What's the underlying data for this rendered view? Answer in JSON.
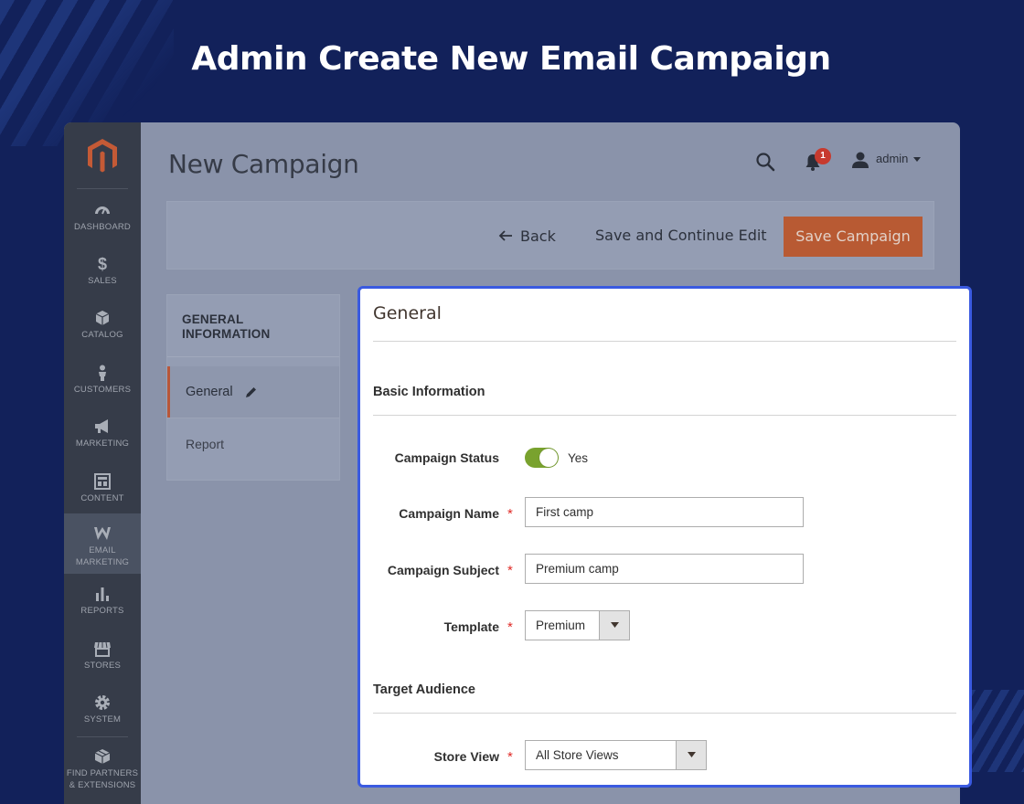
{
  "banner": {
    "title": "Admin Create New Email Campaign"
  },
  "sidebar": {
    "logo_icon": "magento-logo-icon",
    "items": [
      {
        "label": "DASHBOARD",
        "icon": "dashboard-icon"
      },
      {
        "label": "SALES",
        "icon": "dollar-icon"
      },
      {
        "label": "CATALOG",
        "icon": "cube-icon"
      },
      {
        "label": "CUSTOMERS",
        "icon": "person-icon"
      },
      {
        "label": "MARKETING",
        "icon": "megaphone-icon"
      },
      {
        "label": "CONTENT",
        "icon": "layout-icon"
      },
      {
        "label": "EMAIL MARKETING",
        "icon": "email-marketing-icon"
      },
      {
        "label": "REPORTS",
        "icon": "bar-chart-icon"
      },
      {
        "label": "STORES",
        "icon": "store-icon"
      },
      {
        "label": "SYSTEM",
        "icon": "gear-icon"
      },
      {
        "label": "FIND PARTNERS & EXTENSIONS",
        "icon": "box-icon"
      }
    ],
    "active": "EMAIL MARKETING"
  },
  "header": {
    "page_title": "New Campaign",
    "notification_count": "1",
    "username": "admin"
  },
  "actions": {
    "back_label": "Back",
    "save_continue_label": "Save and Continue Edit",
    "save_label": "Save Campaign"
  },
  "tabs": {
    "title": "GENERAL INFORMATION",
    "items": [
      {
        "label": "General",
        "active": true
      },
      {
        "label": "Report",
        "active": false
      }
    ]
  },
  "form": {
    "card_title": "General",
    "basic_section": "Basic Information",
    "status": {
      "label": "Campaign Status",
      "value": "Yes",
      "enabled": true
    },
    "name": {
      "label": "Campaign Name",
      "value": "First camp"
    },
    "subject": {
      "label": "Campaign Subject",
      "value": "Premium camp"
    },
    "template": {
      "label": "Template",
      "value": "Premium"
    },
    "audience_section": "Target Audience",
    "store_view": {
      "label": "Store View",
      "value": "All Store Views"
    },
    "required_mark": "*"
  },
  "colors": {
    "background": "#12215a",
    "accent_border": "#3a5ae0",
    "save_button": "#b85a33",
    "toggle_on": "#79a22e",
    "required": "#e02b27"
  }
}
